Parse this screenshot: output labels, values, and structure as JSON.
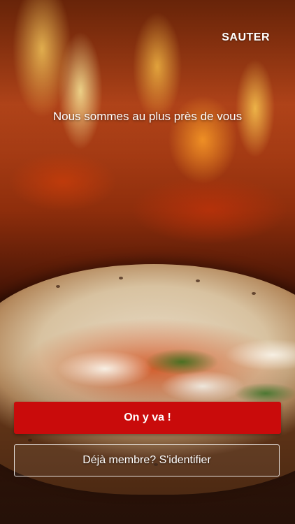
{
  "header": {
    "skip_label": "SAUTER"
  },
  "onboarding": {
    "tagline": "Nous sommes au plus près de vous"
  },
  "actions": {
    "primary_label": "On y va !",
    "secondary_label": "Déjà membre? S'identifier"
  },
  "colors": {
    "primary_button": "#c90b0b",
    "text": "#ffffff"
  }
}
